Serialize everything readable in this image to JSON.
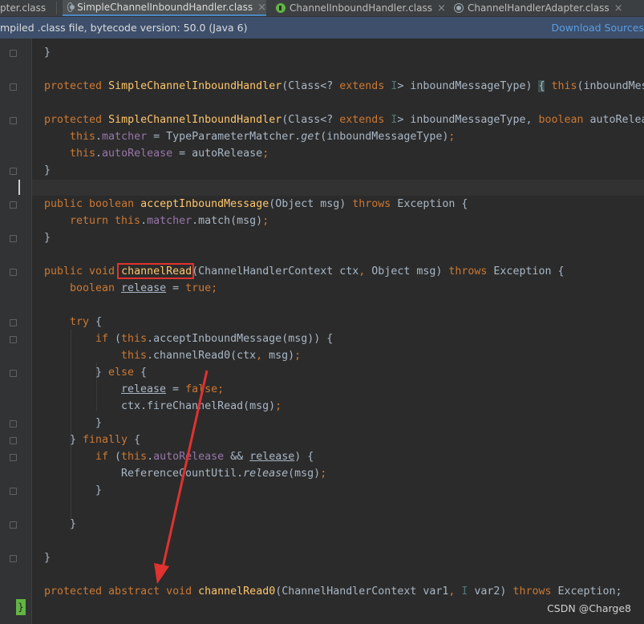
{
  "tabs": [
    {
      "label": "pter.class",
      "icon": "class-icon",
      "active": false
    },
    {
      "label": "SimpleChannelInboundHandler.class",
      "icon": "class-icon",
      "active": true
    },
    {
      "label": "ChannelInboundHandler.class",
      "icon": "interface-icon",
      "active": false
    },
    {
      "label": "ChannelHandlerAdapter.class",
      "icon": "class-icon",
      "active": false
    }
  ],
  "infobar": {
    "message": "mpiled .class file, bytecode version: 50.0 (Java 6)",
    "link": "Download Sources"
  },
  "code": {
    "l1": "}",
    "l2": [
      {
        "t": "protected ",
        "c": "kw"
      },
      {
        "t": "SimpleChannelInboundHandler",
        "c": "fn"
      },
      {
        "t": "(Class<? ",
        "c": ""
      },
      {
        "t": "extends ",
        "c": "kw"
      },
      {
        "t": "I",
        "c": "gen"
      },
      {
        "t": "> inboundMessageType) ",
        "c": ""
      },
      {
        "t": "{",
        "c": "bracehl"
      },
      {
        "t": " ",
        "c": ""
      },
      {
        "t": "this",
        "c": "kw"
      },
      {
        "t": "(inboundMes",
        "c": ""
      }
    ],
    "l3": [
      {
        "t": "protected ",
        "c": "kw"
      },
      {
        "t": "SimpleChannelInboundHandler",
        "c": "fn"
      },
      {
        "t": "(Class<? ",
        "c": ""
      },
      {
        "t": "extends ",
        "c": "kw"
      },
      {
        "t": "I",
        "c": "gen"
      },
      {
        "t": "> inboundMessageType, ",
        "c": ""
      },
      {
        "t": "boolean ",
        "c": "kw"
      },
      {
        "t": "autoRelea",
        "c": ""
      }
    ],
    "l4": [
      {
        "t": "this",
        "c": "kw"
      },
      {
        "t": ".",
        "c": ""
      },
      {
        "t": "matcher",
        "c": "fld"
      },
      {
        "t": " = TypeParameterMatcher.",
        "c": ""
      },
      {
        "t": "get",
        "c": "it"
      },
      {
        "t": "(inboundMessageType)",
        "c": ""
      },
      {
        "t": ";",
        "c": "kw"
      }
    ],
    "l5": [
      {
        "t": "this",
        "c": "kw"
      },
      {
        "t": ".",
        "c": ""
      },
      {
        "t": "autoRelease",
        "c": "fld"
      },
      {
        "t": " = autoRelease",
        "c": ""
      },
      {
        "t": ";",
        "c": "kw"
      }
    ],
    "l6": "}",
    "l7": [
      {
        "t": "public boolean ",
        "c": "kw"
      },
      {
        "t": "acceptInboundMessage",
        "c": "fn"
      },
      {
        "t": "(Object msg) ",
        "c": ""
      },
      {
        "t": "throws ",
        "c": "kw"
      },
      {
        "t": "Exception {",
        "c": ""
      }
    ],
    "l8": [
      {
        "t": "return this",
        "c": "kw"
      },
      {
        "t": ".",
        "c": ""
      },
      {
        "t": "matcher",
        "c": "fld"
      },
      {
        "t": ".match(msg)",
        "c": ""
      },
      {
        "t": ";",
        "c": "kw"
      }
    ],
    "l9": "}",
    "l10": [
      {
        "t": "public void ",
        "c": "kw"
      },
      {
        "t": "channelRead",
        "c": "fn"
      },
      {
        "t": "(ChannelHandlerContext ctx",
        "c": ""
      },
      {
        "t": ", ",
        "c": "kw"
      },
      {
        "t": "Object msg) ",
        "c": ""
      },
      {
        "t": "throws ",
        "c": "kw"
      },
      {
        "t": "Exception {",
        "c": ""
      }
    ],
    "l11": [
      {
        "t": "boolean ",
        "c": "kw"
      },
      {
        "t": "release",
        "c": "ul"
      },
      {
        "t": " = ",
        "c": ""
      },
      {
        "t": "true;",
        "c": "kw"
      }
    ],
    "l12": [
      {
        "t": "try ",
        "c": "kw"
      },
      {
        "t": "{",
        "c": ""
      }
    ],
    "l13": [
      {
        "t": "if ",
        "c": "kw"
      },
      {
        "t": "(",
        "c": ""
      },
      {
        "t": "this",
        "c": "kw"
      },
      {
        "t": ".acceptInboundMessage(msg)) {",
        "c": ""
      }
    ],
    "l14": [
      {
        "t": "this",
        "c": "kw"
      },
      {
        "t": ".channelRead0(ctx",
        "c": ""
      },
      {
        "t": ", ",
        "c": "kw"
      },
      {
        "t": "msg)",
        "c": ""
      },
      {
        "t": ";",
        "c": "kw"
      }
    ],
    "l15": [
      {
        "t": "} ",
        "c": ""
      },
      {
        "t": "else ",
        "c": "kw"
      },
      {
        "t": "{",
        "c": ""
      }
    ],
    "l16": [
      {
        "t": "release",
        "c": "ul"
      },
      {
        "t": " = ",
        "c": ""
      },
      {
        "t": "false;",
        "c": "kw"
      }
    ],
    "l17": [
      {
        "t": "ctx.fireChannelRead(msg)",
        "c": ""
      },
      {
        "t": ";",
        "c": "kw"
      }
    ],
    "l18": "}",
    "l19": [
      {
        "t": "} ",
        "c": ""
      },
      {
        "t": "finally ",
        "c": "kw"
      },
      {
        "t": "{",
        "c": ""
      }
    ],
    "l20": [
      {
        "t": "if ",
        "c": "kw"
      },
      {
        "t": "(",
        "c": ""
      },
      {
        "t": "this",
        "c": "kw"
      },
      {
        "t": ".",
        "c": ""
      },
      {
        "t": "autoRelease",
        "c": "fld"
      },
      {
        "t": " && ",
        "c": ""
      },
      {
        "t": "release",
        "c": "ul"
      },
      {
        "t": ") {",
        "c": ""
      }
    ],
    "l21": [
      {
        "t": "ReferenceCountUtil.",
        "c": ""
      },
      {
        "t": "release",
        "c": "it"
      },
      {
        "t": "(msg)",
        "c": ""
      },
      {
        "t": ";",
        "c": "kw"
      }
    ],
    "l22": "}",
    "l23": "}",
    "l24": "}",
    "l25": [
      {
        "t": "protected abstract void ",
        "c": "kw"
      },
      {
        "t": "channelRead0",
        "c": "fn"
      },
      {
        "t": "(ChannelHandlerContext var1",
        "c": ""
      },
      {
        "t": ", ",
        "c": "kw"
      },
      {
        "t": "I ",
        "c": "gen"
      },
      {
        "t": "var2) ",
        "c": ""
      },
      {
        "t": "throws ",
        "c": "kw"
      },
      {
        "t": "Exception;",
        "c": ""
      }
    ]
  },
  "last_gutter_mark": "}",
  "watermark": "CSDN @Charge8",
  "colors": {
    "background": "#2b2b2b",
    "keyword": "#cc7832",
    "method": "#ffc66d",
    "field": "#9876aa",
    "highlight_box": "#e0322f",
    "arrow": "#e0322f"
  }
}
